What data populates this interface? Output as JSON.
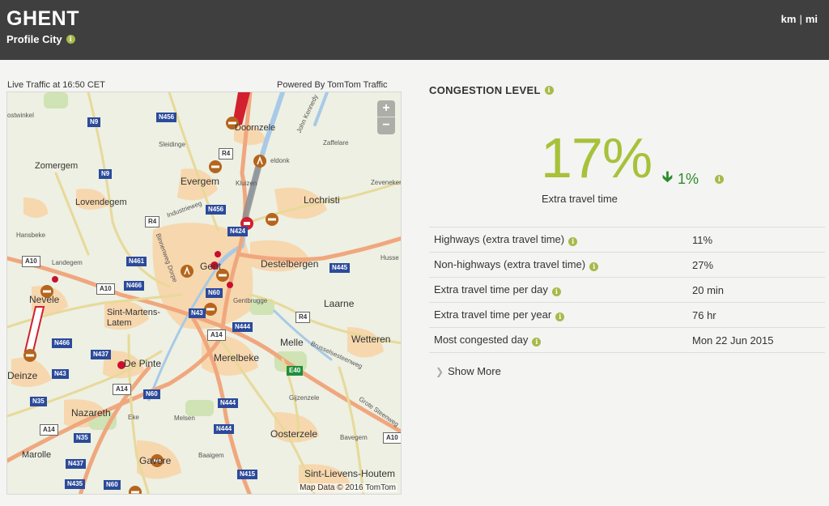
{
  "header": {
    "city": "GHENT",
    "subtitle": "Profile City",
    "units": {
      "km": "km",
      "sep": "|",
      "mi": "mi"
    }
  },
  "map": {
    "live_label": "Live Traffic at 16:50 CET",
    "powered_label": "Powered By TomTom Traffic",
    "attribution": "Map Data © 2016 TomTom",
    "zoom_in": "+",
    "zoom_out": "−",
    "labels": {
      "doornzele": "Doornzele",
      "sleidinge": "Sleidinge",
      "zomergem": "Zomergem",
      "evergem": "Evergem",
      "zaffelare": "Zaffelare",
      "lovendegem": "Lovendegem",
      "lochristi": "Lochristi",
      "zeveneken": "Zeveneken",
      "industrieweg": "Industrieweg",
      "hansbeke": "Hansbeke",
      "landegem": "Landegem",
      "gent": "Gent",
      "destelbergen": "Destelbergen",
      "husse": "Husse",
      "nevele": "Nevele",
      "sint_martens_latem": "Sint-Martens-\nLatem",
      "gentbrugge": "Gentbrugge",
      "laarne": "Laarne",
      "melle": "Melle",
      "wetteren": "Wetteren",
      "merelbeke": "Merelbeke",
      "de_pinte": "De Pinte",
      "deinze": "Deinze",
      "nazareth": "Nazareth",
      "gijzenzele": "Gijzenzele",
      "eke": "Eke",
      "melsen": "Melsen",
      "oosterzele": "Oosterzele",
      "bavegem": "Bavegem",
      "marolle": "Marolle",
      "baaigem": "Baaigem",
      "gavere": "Gavere",
      "sint_lievens_houtem": "Sint-Lievens-Houtem",
      "oostwinkel": "ostwinkel",
      "kennedy": "John Kennedy",
      "brusselsesteenweg": "Brusselsesteenweg",
      "grote_steenweg": "Grote Steenweg",
      "ringvaart": "Binnenweg Dorpe",
      "kluizen": "Kluizen",
      "eldonk": "eldonk"
    },
    "shields": {
      "n456": "N456",
      "n9a": "N9",
      "n9b": "N9",
      "r4a": "R4",
      "r4b": "R4",
      "r4c": "R4",
      "n456b": "N456",
      "n424": "N424",
      "a10a": "A10",
      "a10b": "A10",
      "n461": "N461",
      "n466": "N466",
      "n60a": "N60",
      "n43a": "N43",
      "n445": "N445",
      "n444a": "N444",
      "a14a": "A14",
      "n466b": "N466",
      "n437a": "N437",
      "n43b": "N43",
      "a14b": "A14",
      "n60b": "N60",
      "n35a": "N35",
      "a14c": "A14",
      "n444b": "N444",
      "n35b": "N35",
      "n444c": "N444",
      "n437b": "N437",
      "n435": "N435",
      "n60c": "N60",
      "n415": "N415",
      "a10c": "A10",
      "e40": "E40"
    }
  },
  "congestion": {
    "title": "CONGESTION LEVEL",
    "percent": "17%",
    "delta": "1%",
    "extra_label": "Extra travel time",
    "rows": [
      {
        "label": "Highways (extra travel time)",
        "value": "11%"
      },
      {
        "label": "Non-highways (extra travel time)",
        "value": "27%"
      },
      {
        "label": "Extra travel time per day",
        "value": "20 min"
      },
      {
        "label": "Extra travel time per year",
        "value": "76 hr"
      },
      {
        "label": "Most congested day",
        "value": "Mon 22 Jun 2015"
      }
    ],
    "show_more": "Show More"
  },
  "colors": {
    "header_bg": "#3f3f3f",
    "accent_green": "#a7c13a",
    "delta_green": "#2e8b2e",
    "info_icon": "#a9b94a",
    "jam_red": "#c8102e",
    "incident_orange": "#b5651d"
  }
}
